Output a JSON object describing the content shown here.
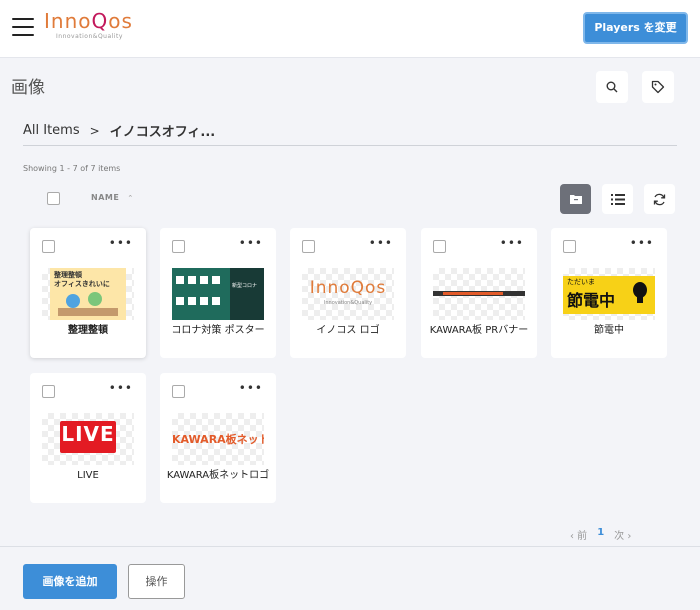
{
  "header": {
    "logo_main": "InnoQos",
    "logo_sub": "Innovation&Quality",
    "players_button": "Players を変更"
  },
  "page": {
    "title": "画像"
  },
  "breadcrumb": {
    "root": "All Items",
    "separator": ">",
    "current": "イノコスオフィ..."
  },
  "list": {
    "showing": "Showing 1 - 7 of 7 items",
    "name_header": "NAME",
    "items": [
      {
        "title": "整理整頓",
        "thumb_text": "整理整頓\nオフィスきれいに"
      },
      {
        "title": "コロナ対策 ポスター",
        "thumb_text": "新型コロナ"
      },
      {
        "title": "イノコス ロゴ",
        "thumb_text": "InnoQos",
        "thumb_sub": "Innovation&Quality"
      },
      {
        "title": "KAWARA板 PRバナー",
        "thumb_text": ""
      },
      {
        "title": "節電中",
        "thumb_top": "ただいま",
        "thumb_text": "節電中"
      },
      {
        "title": "LIVE",
        "thumb_text": "LIVE"
      },
      {
        "title": "KAWARA板ネットロゴ",
        "thumb_text": "KAWARA板ネット"
      }
    ]
  },
  "pagination": {
    "prev": "‹ 前",
    "page": "1",
    "next": "次 ›"
  },
  "footer": {
    "add_button": "画像を追加",
    "operation_button": "操作"
  },
  "colors": {
    "primary": "#3d8ed8",
    "background": "#f3f4f8"
  }
}
